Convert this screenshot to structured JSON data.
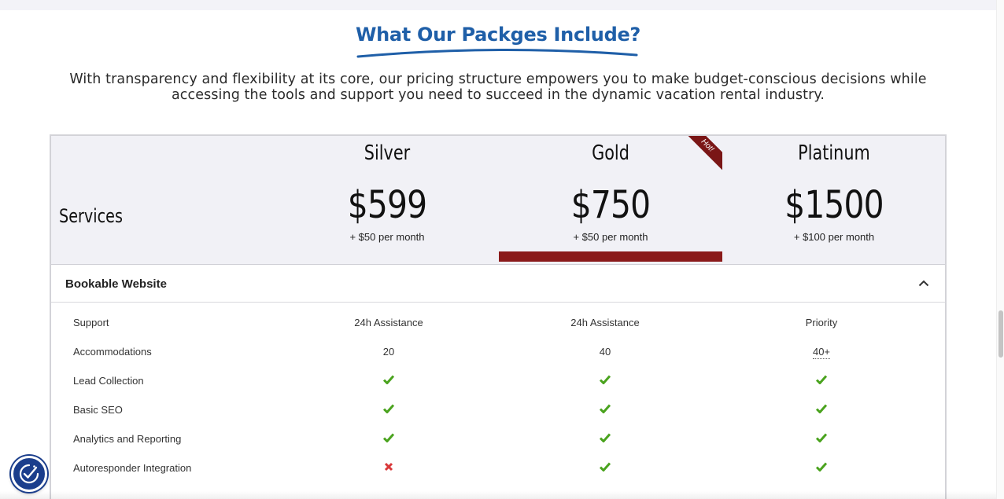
{
  "heading": "What Our Packges Include?",
  "subtitle": "With transparency and flexibility at its core, our pricing structure empowers you to make budget-conscious decisions while accessing the tools and support you need to succeed in the dynamic vacation rental industry.",
  "pricing": {
    "row_header": "Services",
    "ribbon_text": "Hot!",
    "plans": [
      {
        "name": "Silver",
        "price": "$599",
        "monthly": "+ $50 per month"
      },
      {
        "name": "Gold",
        "price": "$750",
        "monthly": "+ $50 per month"
      },
      {
        "name": "Platinum",
        "price": "$1500",
        "monthly": "+ $100 per month"
      }
    ],
    "section": {
      "title": "Bookable Website",
      "rows": [
        {
          "label": "Support",
          "values": [
            "24h Assistance",
            "24h Assistance",
            "Priority"
          ]
        },
        {
          "label": "Accommodations",
          "values": [
            "20",
            "40",
            "40+"
          ]
        },
        {
          "label": "Lead Collection",
          "values": [
            "check",
            "check",
            "check"
          ]
        },
        {
          "label": "Basic SEO",
          "values": [
            "check",
            "check",
            "check"
          ]
        },
        {
          "label": "Analytics and Reporting",
          "values": [
            "check",
            "check",
            "check"
          ]
        },
        {
          "label": "Autoresponder Integration",
          "values": [
            "cross",
            "check",
            "check"
          ]
        }
      ]
    }
  },
  "colors": {
    "heading": "#1f5fa8",
    "gold_bar": "#8a1a1a",
    "check": "#4aa31e",
    "cross": "#d9383a",
    "a11y_button": "#1b3e8c"
  },
  "icons": {
    "check": "check-icon",
    "cross": "cross-icon",
    "chevron": "chevron-up-icon",
    "accessibility": "accessibility-icon"
  }
}
